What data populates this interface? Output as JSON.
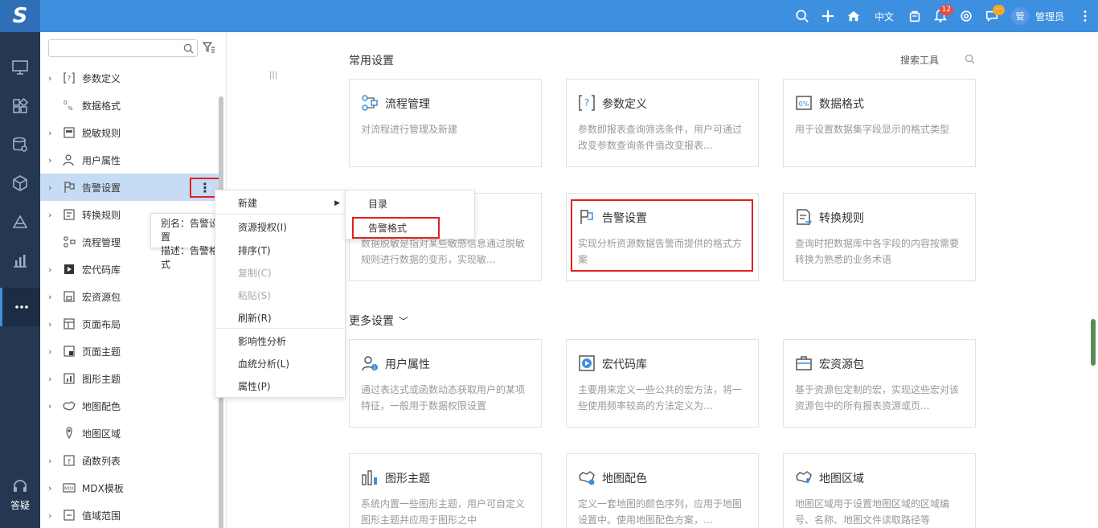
{
  "topbar": {
    "logo": "S",
    "lang": "中文",
    "notifications_badge": "12",
    "messages_badge": "···",
    "avatar": "管",
    "username": "管理员"
  },
  "rail": {
    "help_label": "答疑"
  },
  "tree": {
    "search_placeholder": "",
    "items": [
      {
        "label": "参数定义",
        "icon": "param-icon",
        "arrow": true
      },
      {
        "label": "数据格式",
        "icon": "data-format-icon",
        "arrow": false
      },
      {
        "label": "脱敏规则",
        "icon": "mask-rule-icon",
        "arrow": true
      },
      {
        "label": "用户属性",
        "icon": "user-attr-icon",
        "arrow": true
      },
      {
        "label": "告警设置",
        "icon": "alert-flag-icon",
        "arrow": true
      },
      {
        "label": "转换规则",
        "icon": "convert-rule-icon",
        "arrow": true
      },
      {
        "label": "流程管理",
        "icon": "flow-icon",
        "arrow": false
      },
      {
        "label": "宏代码库",
        "icon": "macro-code-icon",
        "arrow": true
      },
      {
        "label": "宏资源包",
        "icon": "macro-package-icon",
        "arrow": true
      },
      {
        "label": "页面布局",
        "icon": "page-layout-icon",
        "arrow": true
      },
      {
        "label": "页面主题",
        "icon": "page-theme-icon",
        "arrow": true
      },
      {
        "label": "图形主题",
        "icon": "chart-theme-icon",
        "arrow": true
      },
      {
        "label": "地图配色",
        "icon": "map-color-icon",
        "arrow": true
      },
      {
        "label": "地图区域",
        "icon": "map-region-icon",
        "arrow": false
      },
      {
        "label": "函数列表",
        "icon": "function-list-icon",
        "arrow": true
      },
      {
        "label": "MDX模板",
        "icon": "mdx-icon",
        "arrow": true
      },
      {
        "label": "值域范围",
        "icon": "value-range-icon",
        "arrow": true
      }
    ],
    "tooltip": {
      "alias": "别名：告警设置",
      "desc": "描述：告警格式"
    }
  },
  "context_menu": {
    "new": "新建",
    "grant": "资源授权(I)",
    "sort": "排序(T)",
    "copy": "复制(C)",
    "paste": "粘贴(S)",
    "refresh": "刷新(R)",
    "impact": "影响性分析",
    "lineage": "血统分析(L)",
    "props": "属性(P)"
  },
  "submenu": {
    "folder": "目录",
    "alert_format": "告警格式"
  },
  "main": {
    "common_title": "常用设置",
    "search_tool": "搜索工具",
    "more_title": "更多设置",
    "cards": [
      {
        "title": "流程管理",
        "desc": "对流程进行管理及新建"
      },
      {
        "title": "参数定义",
        "desc": "参数即报表查询筛选条件，用户可通过改变参数查询条件值改变报表..."
      },
      {
        "title": "数据格式",
        "desc": "用于设置数据集字段显示的格式类型"
      },
      {
        "title": "",
        "desc": "数据脱敏是指对某些敏感信息通过脱敏规则进行数据的变形，实现敏..."
      },
      {
        "title": "告警设置",
        "desc": "实现分析资源数据告警而提供的格式方案"
      },
      {
        "title": "转换规则",
        "desc": "查询时把数据库中各字段的内容按需要转换为熟悉的业务术语"
      },
      {
        "title": "用户属性",
        "desc": "通过表达式或函数动态获取用户的某项特征，一般用于数据权限设置"
      },
      {
        "title": "宏代码库",
        "desc": "主要用来定义一些公共的宏方法，将一些使用频率较高的方法定义为..."
      },
      {
        "title": "宏资源包",
        "desc": "基于资源包定制的宏，实现这些宏对该资源包中的所有报表资源或页..."
      },
      {
        "title": "图形主题",
        "desc": "系统内置一些图形主题，用户可自定义图形主题并应用于图形之中"
      },
      {
        "title": "地图配色",
        "desc": "定义一套地图的颜色序列，应用于地图设置中。使用地图配色方案，..."
      },
      {
        "title": "地图区域",
        "desc": "地图区域用于设置地图区域的区域编号、名称、地图文件读取路径等"
      }
    ]
  }
}
